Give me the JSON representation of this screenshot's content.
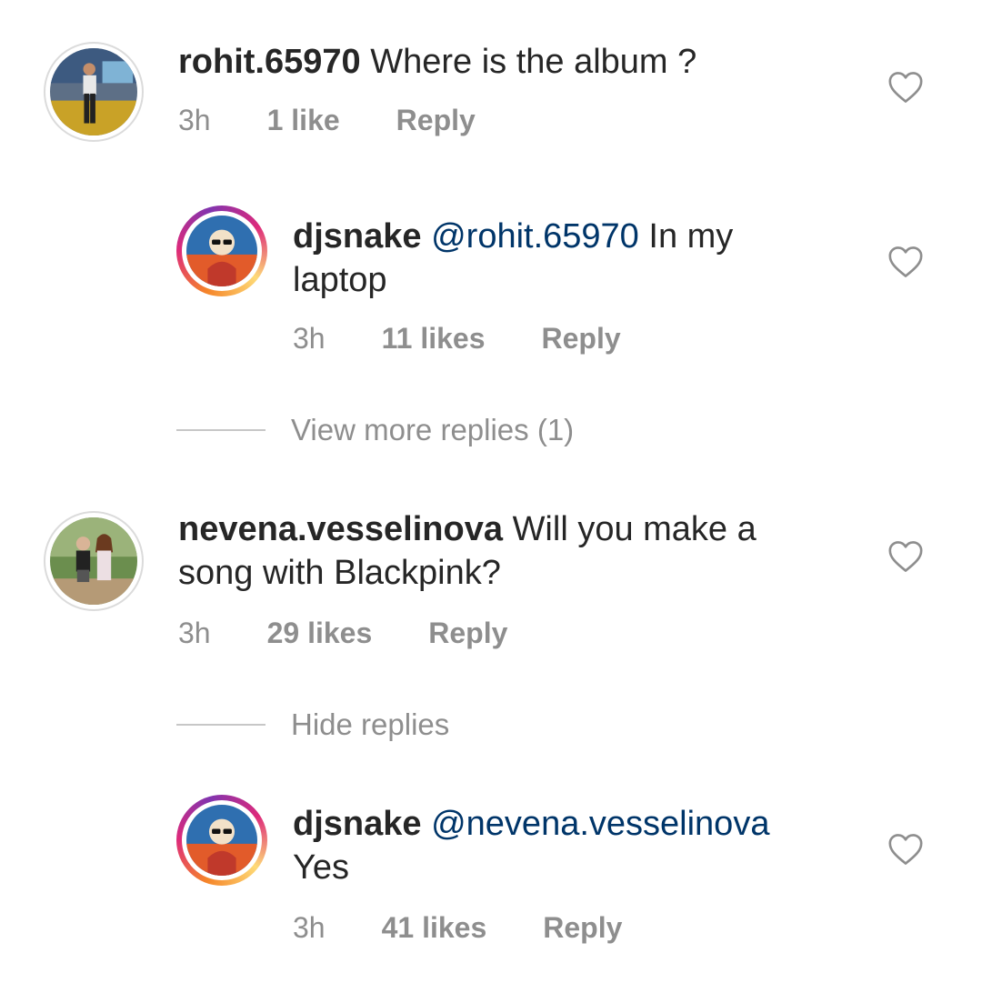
{
  "comments": [
    {
      "username": "rohit.65970",
      "text": "Where is the album ?",
      "time": "3h",
      "likes": "1 like",
      "reply": "Reply"
    },
    {
      "username": "djsnake",
      "mention": "@rohit.65970",
      "text_line1": "In my",
      "text_line2": "laptop",
      "time": "3h",
      "likes": "11 likes",
      "reply": "Reply"
    },
    {
      "username": "nevena.vesselinova",
      "text_line1": "Will you make a",
      "text_line2": "song with Blackpink?",
      "time": "3h",
      "likes": "29 likes",
      "reply": "Reply"
    },
    {
      "username": "djsnake",
      "mention": "@nevena.vesselinova",
      "text_line2": "Yes",
      "time": "3h",
      "likes": "41 likes",
      "reply": "Reply"
    }
  ],
  "toggles": {
    "view_more": "View more replies (1)",
    "hide": "Hide replies"
  },
  "colors": {
    "mention": "#003569",
    "meta": "#8e8e8e",
    "text": "#262626"
  },
  "icons": {
    "like": "heart-outline-icon"
  }
}
